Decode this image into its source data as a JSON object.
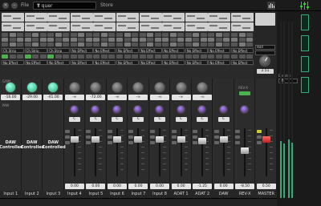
{
  "topbar": {
    "file_label": "File",
    "file_value": "1 quer",
    "store_label": "Store"
  },
  "inserts": [
    {
      "top": "Ch.Strip",
      "bottom": "No Effect"
    },
    {
      "top": "Ch.Strip",
      "bottom": "No Effect"
    },
    {
      "top": "Ch.Strip",
      "bottom": "No Effect"
    },
    {
      "top": "No Effect",
      "bottom": "No Effect"
    },
    {
      "top": "No Effect",
      "bottom": "No Effect"
    },
    {
      "top": "No Effect",
      "bottom": "No Effect"
    },
    {
      "top": "No Effect",
      "bottom": "No Effect"
    },
    {
      "top": "No Effect",
      "bottom": "No Effect"
    },
    {
      "top": "No Effect",
      "bottom": "No Effect"
    },
    {
      "top": "No Effect",
      "bottom": "No Effect"
    },
    {
      "top": "No Effect",
      "bottom": "No Effect"
    }
  ],
  "reverb_panel": {
    "type": "Hall",
    "select2": "",
    "value": "2.51",
    "mode": "Off",
    "label": "Empfeh"
  },
  "section_labels": {
    "gain": "GAIN",
    "pan": "PAN",
    "rev_x": "REV-X"
  },
  "strips": [
    {
      "name": "Input 1",
      "gain": "-16.00",
      "daw": "DAW\nControlled",
      "fader": null,
      "pan": null
    },
    {
      "name": "Input 2",
      "gain": "-29.00",
      "daw": "DAW\nControlled",
      "fader": null,
      "pan": null
    },
    {
      "name": "Input 3",
      "gain": "-41.00",
      "daw": "DAW\nControlled",
      "fader": null,
      "pan": null
    },
    {
      "name": "Input 4",
      "gain": "-∞",
      "daw": "",
      "fader": "0.00",
      "pan": "C"
    },
    {
      "name": "Input 5",
      "gain": "-72.00",
      "daw": "",
      "fader": "0.00",
      "pan": "C"
    },
    {
      "name": "Input 6",
      "gain": "-∞",
      "daw": "",
      "fader": "0.00",
      "pan": "C"
    },
    {
      "name": "Input 7",
      "gain": "-∞",
      "daw": "",
      "fader": "0.00",
      "pan": "C"
    },
    {
      "name": "Input 8",
      "gain": "-∞",
      "daw": "",
      "fader": "0.00",
      "pan": "C"
    },
    {
      "name": "ADAT 1",
      "gain": "-∞",
      "daw": "",
      "fader": "0.00",
      "pan": "C"
    },
    {
      "name": "ADAT 2",
      "gain": "-∞",
      "daw": "",
      "fader": "-1.25",
      "pan": "C"
    },
    {
      "name": "DAW",
      "gain": "",
      "daw": "",
      "fader": "0.00",
      "pan": "C"
    },
    {
      "name": "REV-X",
      "gain": "",
      "daw": "",
      "fader": "-8.50",
      "pan": ""
    },
    {
      "name": "MASTER",
      "gain": "",
      "daw": "",
      "fader": "0.50",
      "pan": ""
    }
  ]
}
